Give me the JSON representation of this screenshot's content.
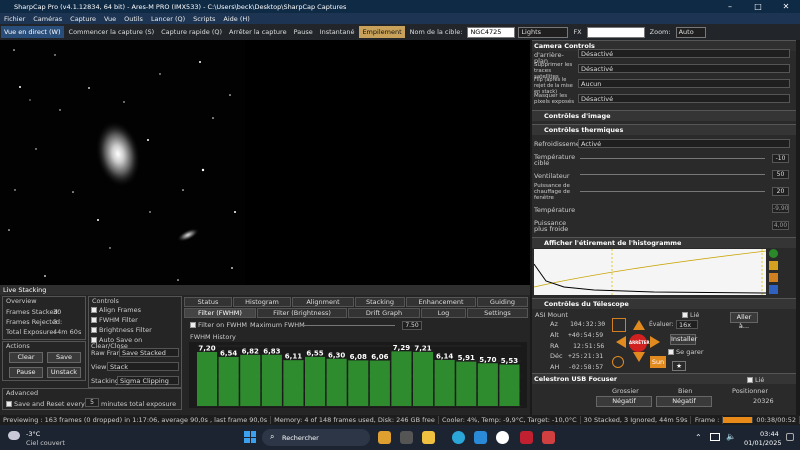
{
  "window": {
    "title": "SharpCap Pro (v4.1.12834, 64 bit) - Ares-M PRO (IMX533) - C:\\Users\\beck\\Desktop\\SharpCap Captures",
    "min": "–",
    "max": "□",
    "close": "✕"
  },
  "menu": [
    "Fichier",
    "Caméras",
    "Capture",
    "Vue",
    "Outils",
    "Lancer (Q)",
    "Scripts",
    "Aide (H)"
  ],
  "toolbar": {
    "live": "Vue en direct (W)",
    "start_capture": "Commencer la capture (S)",
    "quick_capture": "Capture rapide (Q)",
    "stop_capture": "Arrêter la capture",
    "pause": "Pause",
    "snapshot": "Instantané",
    "stacking": "Empilement",
    "target_label": "Nom de la cible:",
    "target_value": "NGC4725",
    "frame_type": "Lights",
    "fx_label": "FX",
    "zoom_label": "Zoom:",
    "zoom_value": "Auto"
  },
  "camera_controls": {
    "header": "Camera Controls",
    "rows": [
      {
        "label": "d'arrière-plan",
        "value": "Désactivé"
      },
      {
        "label": "Supprimer les traces satellites",
        "value": "Désactivé"
      },
      {
        "label": "Flip (après le rejet de la mise en stack)",
        "value": "Aucun"
      },
      {
        "label": "Masquer les pixels exposés",
        "value": "Désactivé"
      }
    ]
  },
  "image_controls": {
    "header": "Contrôles d'image"
  },
  "thermal": {
    "header": "Contrôles thermiques",
    "cooling_label": "Refroidissement",
    "cooling_value": "Activé",
    "temp_target_label": "Température cible",
    "temp_target_value": "-10",
    "fan_label": "Ventilateur",
    "fan_value": "50",
    "heater_label": "Puissance de chauffage de fenêtre",
    "heater_value": "20",
    "temperature_label": "Température",
    "temperature_value": "-9,90",
    "cool_power_label": "Puissance plus froide",
    "cool_power_value": "4,00"
  },
  "histogram": {
    "header": "Afficher l'étirement de l'histogramme"
  },
  "telescope": {
    "header": "Contrôles du Télescope",
    "mount": "ASI Mount",
    "linked_label": "Lié",
    "goto_btn": "Aller à...",
    "az_label": "Az",
    "az": "104:32:30",
    "alt_label": "Alt",
    "alt": "+40:54:59",
    "ra_label": "RA",
    "ra": "12:51:56",
    "dec_label": "Déc",
    "dec": "+25:21:31",
    "ah_label": "AH",
    "ah": "-02:58:57",
    "eval_label": "Évaluer:",
    "eval_value": "16x",
    "install_btn": "Installer",
    "park_label": "Se garer",
    "stop_label": "ARRÊTER",
    "sun_label": "Sun"
  },
  "focuser": {
    "header": "Celestron USB Focuser",
    "linked": "Lié",
    "col1": "Grossier",
    "col2": "Bien",
    "col3": "Positionner",
    "neg1": "Négatif",
    "neg2": "Négatif",
    "position": "20326"
  },
  "live_stacking": {
    "header": "Live Stacking",
    "overview_label": "Overview",
    "frames_stacked_label": "Frames Stacked:",
    "frames_stacked": "30",
    "frames_rejected_label": "Frames Rejected:",
    "frames_rejected": "3",
    "total_exposure_label": "Total Exposure:",
    "total_exposure": "44m 60s",
    "actions_label": "Actions",
    "clear_btn": "Clear",
    "save_btn": "Save",
    "pause_btn": "Pause",
    "unstack_btn": "Unstack",
    "advanced_label": "Advanced",
    "save_reset_label": "Save and Reset every",
    "save_reset_value": "5",
    "save_reset_suffix": "minutes total exposure",
    "controls_label": "Controls",
    "align_label": "Align Frames",
    "fwhm_filter_label": "FWHM Filter",
    "brightness_label": "Brightness Filter",
    "autosave_label": "Auto Save on Clear/Close",
    "raw_frames_label": "Raw Frames",
    "raw_frames_value": "Save Stacked",
    "view_label": "View",
    "view_value": "Stack",
    "stacking_label": "Stacking",
    "stacking_value": "Sigma Clipping",
    "tabs_row1": [
      "Status",
      "Histogram",
      "Alignment",
      "Stacking",
      "Enhancement",
      "Guiding"
    ],
    "tabs_row2": [
      "Filter (FWHM)",
      "Filter (Brightness)",
      "Drift Graph",
      "Log",
      "Settings"
    ],
    "filter_on_label": "Filter on FWHM",
    "max_fwhm_label": "Maximum FWHM",
    "max_fwhm_value": "7.50",
    "history_label": "FWHM History"
  },
  "chart_data": {
    "type": "bar",
    "title": "FWHM History",
    "values": [
      7.2,
      6.54,
      6.82,
      6.83,
      6.11,
      6.55,
      6.3,
      6.08,
      6.06,
      7.29,
      7.21,
      6.14,
      5.91,
      5.7,
      5.53
    ],
    "labels": [
      "7,20",
      "6,54",
      "6,82",
      "6,83",
      "6,11",
      "6,55",
      "6,30",
      "6,08",
      "6,06",
      "7,29",
      "7,21",
      "6,14",
      "5,91",
      "5,70",
      "5,53"
    ],
    "bar_color": "#2e8b2e"
  },
  "status": [
    "Previewing : 163 frames (0 dropped) in 1:17:06, average 90,0s , last frame 90,0s",
    "Memory: 4 of 148 frames used, Disk: 246 GB free",
    "Cooler: 4%, Temp: -9,9°C, Target: -10,0°C",
    "30 Stacked, 3 Ignored, 44m 59s",
    "Frame :",
    "00:38/00:52"
  ],
  "taskbar": {
    "temp": "-3°C",
    "weather": "Ciel couvert",
    "search": "Rechercher",
    "time": "03:44",
    "date": "01/01/2025"
  }
}
